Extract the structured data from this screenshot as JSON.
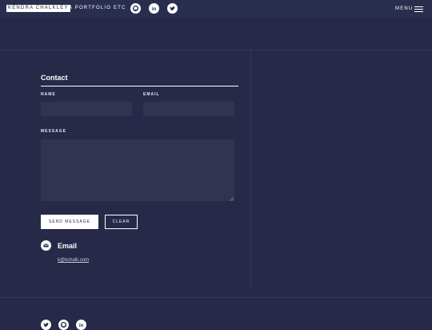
{
  "header": {
    "brand_name": "KENDRA CHALKLEY",
    "tagline": "A PORTFOLIO ETC",
    "social_icons": [
      "github-icon",
      "linkedin-icon",
      "twitter-icon"
    ],
    "menu_label": "MENU"
  },
  "contact": {
    "title": "Contact",
    "name_label": "NAME",
    "name_value": "",
    "email_label": "EMAIL",
    "email_value": "",
    "message_label": "MESSAGE",
    "message_value": "",
    "send_label": "SEND MESSAGE",
    "clear_label": "CLEAR"
  },
  "email_block": {
    "icon": "envelope-icon",
    "heading": "Email",
    "address": "k@kchalk.com"
  },
  "footer": {
    "social_icons": [
      "twitter-icon",
      "github-icon",
      "linkedin-icon"
    ]
  },
  "colors": {
    "background": "#262a48",
    "header_background": "#2a2e4e",
    "field_background": "#303451",
    "divider": "#333858",
    "accent": "#ffffff"
  }
}
